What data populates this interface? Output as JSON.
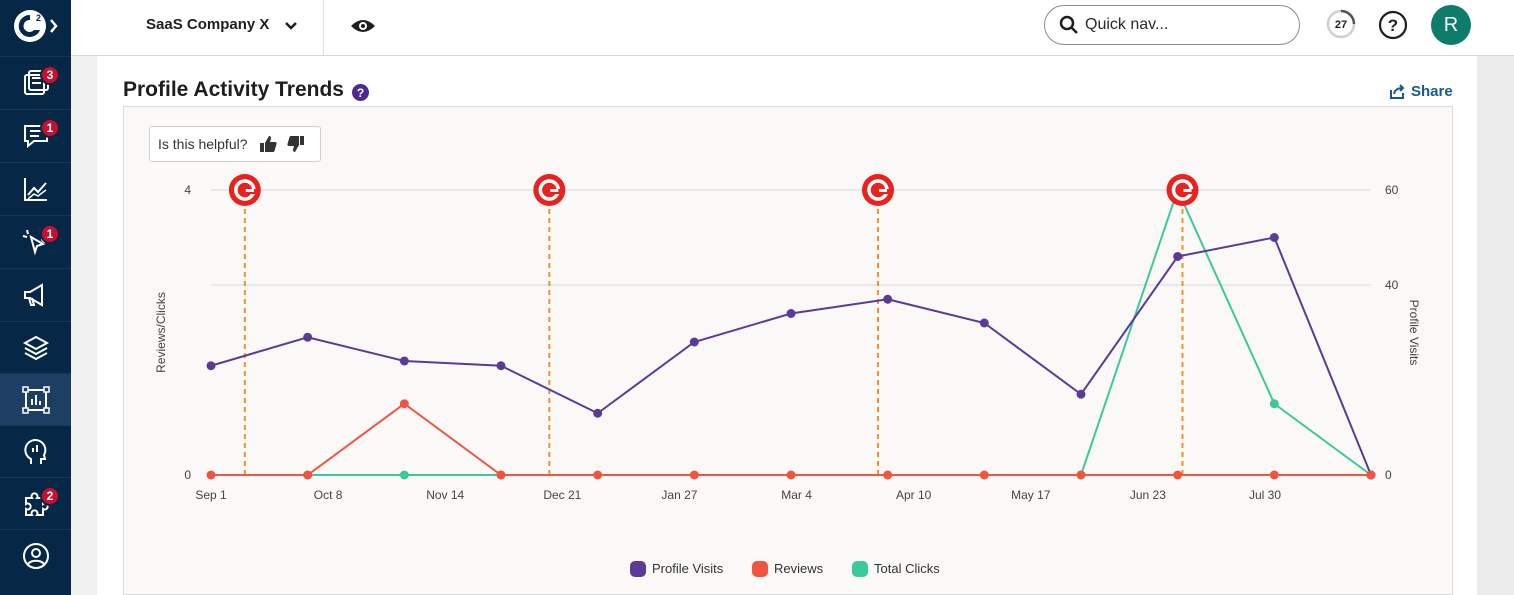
{
  "header": {
    "company": "SaaS Company X",
    "quicknav_placeholder": "Quick nav...",
    "counter": "27",
    "avatar_initial": "R"
  },
  "sidebar": {
    "items": [
      {
        "icon": "dashboard-icon",
        "badge": "3"
      },
      {
        "icon": "chat-icon",
        "badge": "1"
      },
      {
        "icon": "trend-chart-icon",
        "badge": ""
      },
      {
        "icon": "cursor-click-icon",
        "badge": "1"
      },
      {
        "icon": "megaphone-icon",
        "badge": ""
      },
      {
        "icon": "layers-icon",
        "badge": ""
      },
      {
        "icon": "report-frame-icon",
        "badge": "",
        "active": true
      },
      {
        "icon": "head-insight-icon",
        "badge": ""
      },
      {
        "icon": "puzzle-icon",
        "badge": "2"
      },
      {
        "icon": "user-circle-icon",
        "badge": ""
      }
    ]
  },
  "card": {
    "title": "Profile Activity Trends",
    "help_symbol": "?",
    "share_label": "Share",
    "helpful_label": "Is this helpful?"
  },
  "colors": {
    "profile_visits": "#5b3a98",
    "reviews": "#ef5540",
    "total_clicks": "#3cc99a",
    "marker": "#e8231f",
    "marker_line": "#f29225"
  },
  "chart_data": {
    "type": "line",
    "x_ticks": [
      "Sep 1",
      "Oct 8",
      "Nov 14",
      "Dec 21",
      "Jan 27",
      "Mar 4",
      "Apr 10",
      "May 17",
      "Jun 23",
      "Jul 30"
    ],
    "points_x": [
      0,
      1,
      2,
      3,
      4,
      5,
      6,
      7,
      8,
      9,
      10,
      11,
      12
    ],
    "ylabel_left": "Reviews/Clicks",
    "ylabel_right": "Profile Visits",
    "ylim_left": [
      0,
      4
    ],
    "ylim_right": [
      0,
      60
    ],
    "yticks_left": [
      0,
      4
    ],
    "yticks_right": [
      0,
      40,
      60
    ],
    "grid": true,
    "legend_position": "bottom-center",
    "series": [
      {
        "name": "Profile Visits",
        "axis": "right",
        "color": "#5b3a98",
        "values": [
          23,
          29,
          24,
          23,
          13,
          28,
          34,
          37,
          32,
          17,
          46,
          50,
          0
        ]
      },
      {
        "name": "Reviews",
        "axis": "left",
        "color": "#ef5540",
        "values": [
          0,
          0,
          1,
          0,
          0,
          0,
          0,
          0,
          0,
          0,
          0,
          0,
          0
        ]
      },
      {
        "name": "Total Clicks",
        "axis": "left",
        "color": "#3cc99a",
        "values": [
          null,
          0,
          0,
          0,
          null,
          null,
          null,
          null,
          null,
          0,
          4,
          1,
          0
        ]
      }
    ],
    "event_markers_x": [
      0.35,
      3.5,
      6.9,
      10.05
    ]
  }
}
